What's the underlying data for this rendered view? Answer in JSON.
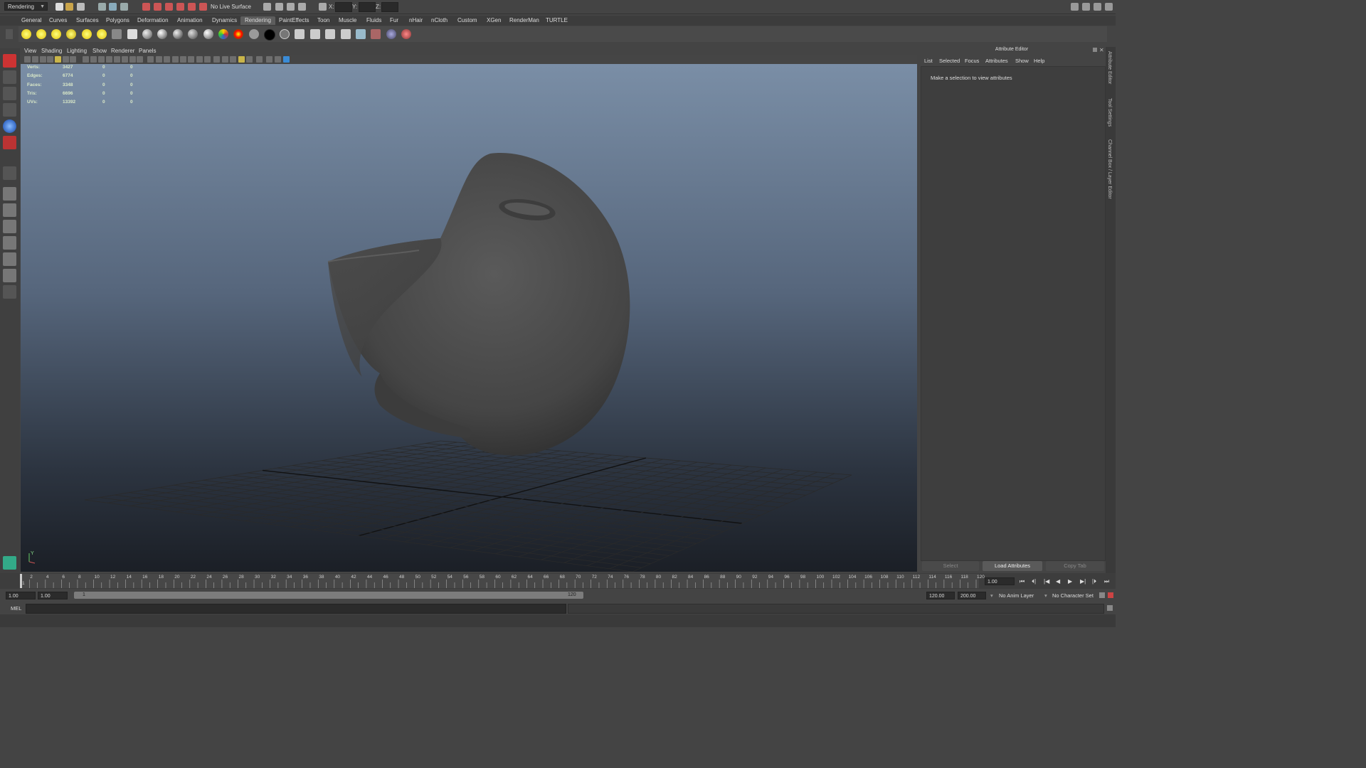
{
  "statusline": {
    "menu_set": "Rendering",
    "live_surface": "No Live Surface",
    "x_label": "X:",
    "y_label": "Y:",
    "z_label": "Z:"
  },
  "shelf_tabs": [
    "General",
    "Curves",
    "Surfaces",
    "Polygons",
    "Deformation",
    "Animation",
    "Dynamics",
    "Rendering",
    "PaintEffects",
    "Toon",
    "Muscle",
    "Fluids",
    "Fur",
    "nHair",
    "nCloth",
    "Custom",
    "XGen",
    "RenderMan",
    "TURTLE"
  ],
  "active_shelf_tab": "Rendering",
  "viewport": {
    "menus": [
      "View",
      "Shading",
      "Lighting",
      "Show",
      "Renderer",
      "Panels"
    ],
    "hud": [
      {
        "label": "Verts:",
        "total": "3427",
        "selected": "0",
        "components": "0"
      },
      {
        "label": "Edges:",
        "total": "6774",
        "selected": "0",
        "components": "0"
      },
      {
        "label": "Faces:",
        "total": "3348",
        "selected": "0",
        "components": "0"
      },
      {
        "label": "Tris:",
        "total": "6696",
        "selected": "0",
        "components": "0"
      },
      {
        "label": "UVs:",
        "total": "13392",
        "selected": "0",
        "components": "0"
      }
    ],
    "axis_label": "Y"
  },
  "attribute_editor": {
    "title": "Attribute Editor",
    "menus": [
      "List",
      "Selected",
      "Focus",
      "Attributes",
      "Show",
      "Help"
    ],
    "message": "Make a selection to view attributes",
    "select_label": "Select",
    "load_label": "Load Attributes",
    "copy_label": "Copy Tab"
  },
  "side_tabs": [
    "Attribute Editor",
    "Tool Settings",
    "Channel Box / Layer Editor"
  ],
  "time_slider": {
    "ticks": [
      "1",
      "2",
      "4",
      "6",
      "8",
      "10",
      "12",
      "14",
      "16",
      "18",
      "20",
      "22",
      "24",
      "26",
      "28",
      "30",
      "32",
      "34",
      "36",
      "38",
      "40",
      "42",
      "44",
      "46",
      "48",
      "50",
      "52",
      "54",
      "56",
      "58",
      "60",
      "62",
      "64",
      "66",
      "68",
      "70",
      "72",
      "74",
      "76",
      "78",
      "80",
      "82",
      "84",
      "86",
      "88",
      "90",
      "92",
      "94",
      "96",
      "98",
      "100",
      "102",
      "104",
      "106",
      "108",
      "110",
      "112",
      "114",
      "116",
      "118",
      "120"
    ],
    "current_frame": "1.00",
    "playback": [
      "⏮",
      "⏴|",
      "|◀",
      "◀",
      "▶",
      "▶|",
      "|⏵",
      "⏭"
    ]
  },
  "range_slider": {
    "start_time": "1.00",
    "playback_start": "1.00",
    "range_start": "1",
    "range_end": "120",
    "playback_end": "120.00",
    "end_time": "200.00",
    "anim_layer": "No Anim Layer",
    "character_set": "No Character Set"
  },
  "command_line": {
    "label": "MEL"
  },
  "colors": {
    "accent_tab": "#5d5d5d",
    "viewport_top": "#7a8ea6",
    "viewport_bottom": "#1b1f26",
    "model": "#4d4d4d"
  }
}
